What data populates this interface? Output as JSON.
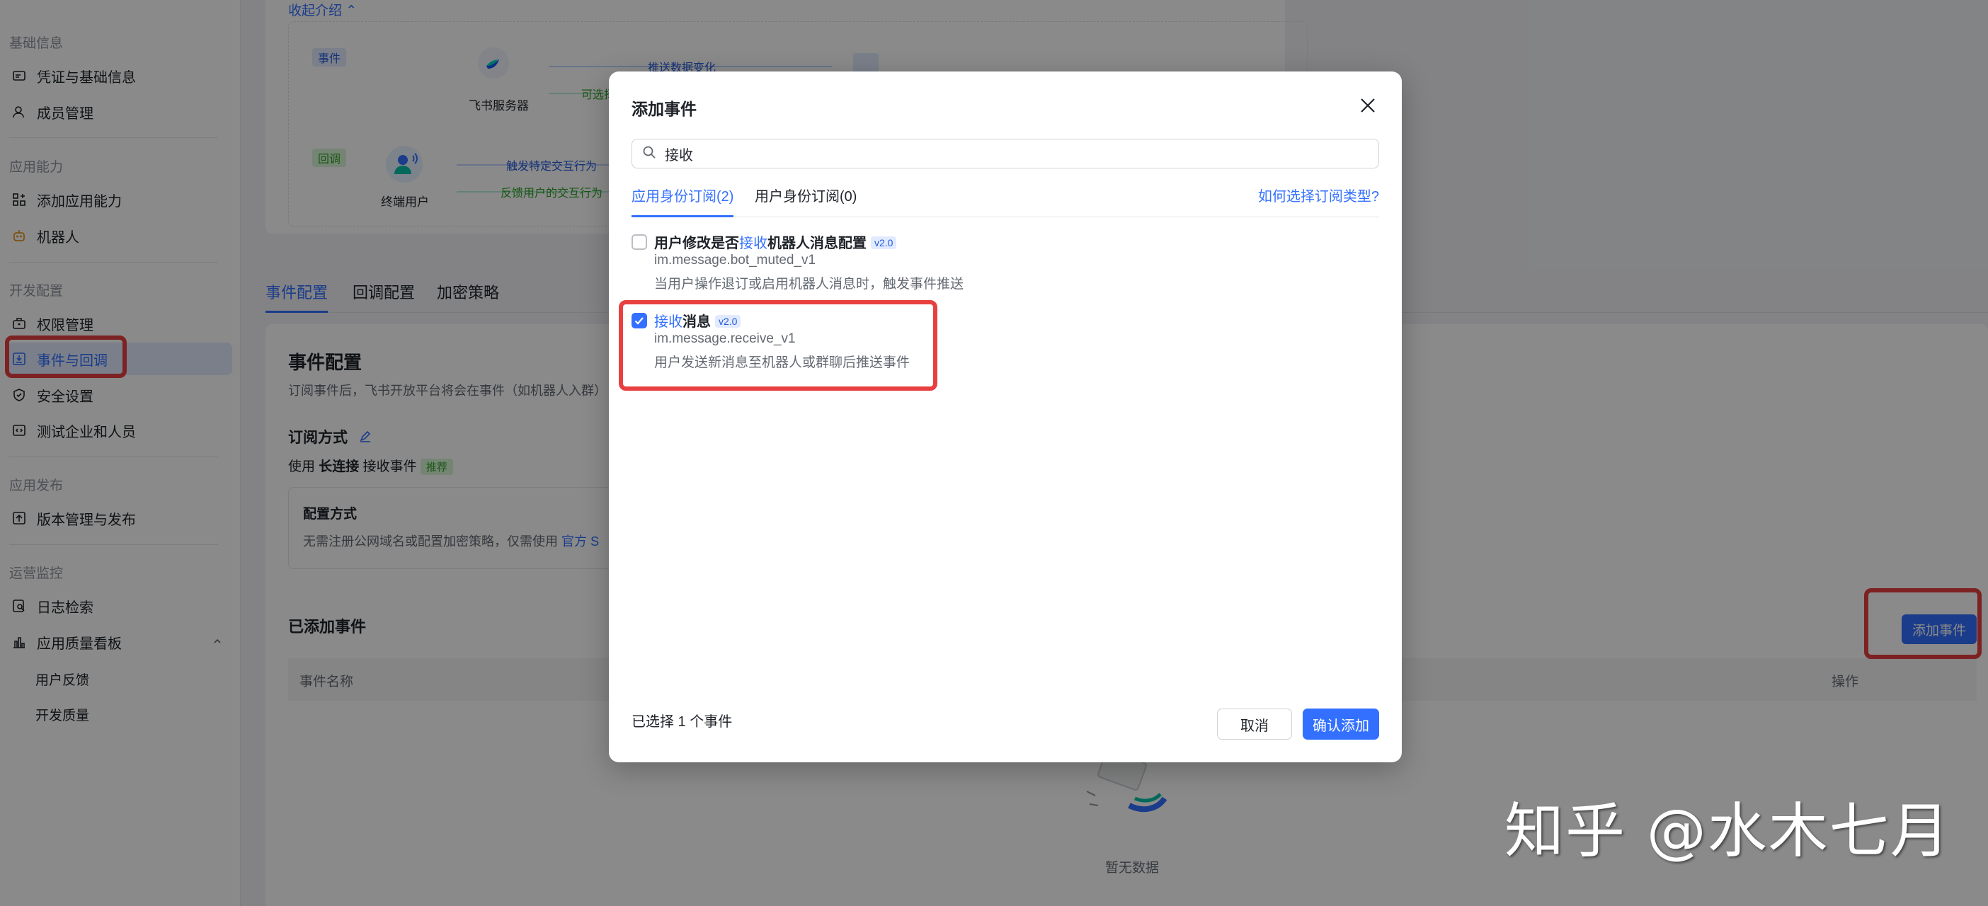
{
  "sidebar": {
    "group_basic": "基础信息",
    "item_credentials": "凭证与基础信息",
    "item_members": "成员管理",
    "group_capability": "应用能力",
    "item_add_capability": "添加应用能力",
    "item_bot": "机器人",
    "group_dev": "开发配置",
    "item_permissions": "权限管理",
    "item_events": "事件与回调",
    "item_security": "安全设置",
    "item_test_org": "测试企业和人员",
    "group_release": "应用发布",
    "item_versions": "版本管理与发布",
    "group_ops": "运营监控",
    "item_logs": "日志检索",
    "item_quality": "应用质量看板",
    "sub_feedback": "用户反馈",
    "sub_dev_quality": "开发质量"
  },
  "diagram": {
    "collapse_link": "收起介绍",
    "event_tag": "事件",
    "feishu_server": "飞书服务器",
    "push_change": "推送数据变化",
    "optional_return": "可选择返回",
    "callback_tag": "回调",
    "trigger_interaction": "触发特定交互行为",
    "feedback_interaction": "反馈用户的交互行为",
    "end_user": "终端用户"
  },
  "page_tabs": [
    "事件配置",
    "回调配置",
    "加密策略"
  ],
  "event_config": {
    "title": "事件配置",
    "desc": "订阅事件后，飞书开放平台将会在事件（如机器人入群）",
    "subscribe_label": "订阅方式",
    "use_prefix": "使用",
    "long_conn": "长连接",
    "receive_events": "接收事件",
    "recommend_tag": "推荐",
    "config_mode_title": "配置方式",
    "config_mode_desc": "无需注册公网域名或配置加密策略，仅需使用",
    "config_mode_link": "官方 S",
    "added_events_title": "已添加事件",
    "add_event_button": "添加事件",
    "col_event_name": "事件名称",
    "col_action": "操作",
    "empty_text": "暂无数据"
  },
  "modal": {
    "title": "添加事件",
    "search_value": "接收",
    "tab_app": "应用身份订阅(2)",
    "tab_user": "用户身份订阅(0)",
    "help_link": "如何选择订阅类型?",
    "events": [
      {
        "title_pre": "用户修改是否",
        "title_hl": "接收",
        "title_post": "机器人消息配置",
        "version": "v2.0",
        "code": "im.message.bot_muted_v1",
        "desc": "当用户操作退订或启用机器人消息时，触发事件推送",
        "checked": false
      },
      {
        "title_pre": "",
        "title_hl": "接收",
        "title_post": "消息",
        "version": "v2.0",
        "code": "im.message.receive_v1",
        "desc": "用户发送新消息至机器人或群聊后推送事件",
        "checked": true
      }
    ],
    "selected_count": "已选择 1 个事件",
    "cancel": "取消",
    "confirm": "确认添加"
  },
  "watermark": "知乎 @水木七月",
  "colors": {
    "accent": "#3370ff",
    "highlight_box": "#e84040"
  }
}
